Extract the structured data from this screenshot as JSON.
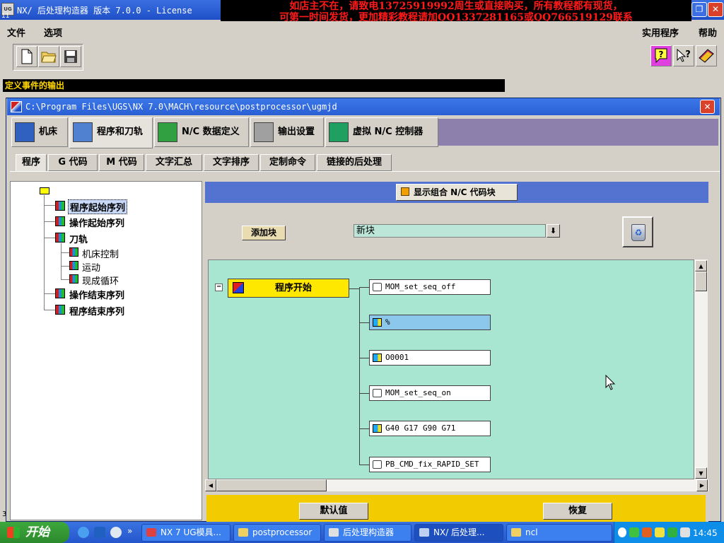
{
  "window": {
    "title": "NX/ 后处理构造器 版本 7.0.0 - License",
    "logo_text": "UG",
    "corner_number": "11",
    "restore_glyph": "❐",
    "close_glyph": "✕"
  },
  "ad_banner": {
    "line1": "如店主不在，请致电13725919992周生或直接购买，所有教程都有现货，",
    "line2": "可第一时间发货，更加精彩教程请加QQ1337281165或QQ766519129联系"
  },
  "menubar": {
    "file": "文件",
    "options": "选项",
    "utilities": "实用程序",
    "help": "帮助"
  },
  "toolbar": {
    "icons": [
      "new-file-icon",
      "open-folder-icon",
      "save-icon",
      "help-question-icon",
      "context-help-icon",
      "manual-book-icon"
    ]
  },
  "status_bar": "定义事件的输出",
  "inner_window": {
    "path": "C:\\Program Files\\UGS\\NX 7.0\\MACH\\resource\\postprocessor\\ugmjd",
    "close_glyph": "✕"
  },
  "main_tabs": [
    {
      "label": "机床",
      "icon": "machine-tool-icon",
      "color": "#3060c0"
    },
    {
      "label": "程序和刀轨",
      "icon": "program-toolpath-icon",
      "color": "#5080d0"
    },
    {
      "label": "N/C 数据定义",
      "icon": "nc-data-icon",
      "color": "#30a040"
    },
    {
      "label": "输出设置",
      "icon": "printer-icon",
      "color": "#a0a0a0"
    },
    {
      "label": "虚拟 N/C 控制器",
      "icon": "virtual-controller-icon",
      "color": "#20a060"
    }
  ],
  "sub_tabs": [
    "程序",
    "G 代码",
    "M 代码",
    "文字汇总",
    "文字排序",
    "定制命令",
    "链接的后处理"
  ],
  "tree": {
    "nodes": [
      "程序起始序列",
      "操作起始序列",
      "刀轨",
      "操作结束序列",
      "程序结束序列"
    ],
    "children": [
      "机床控制",
      "运动",
      "现成循环"
    ]
  },
  "panel": {
    "show_blocks_label": "显示组合 N/C 代码块",
    "add_block_label": "添加块",
    "new_block_value": "新块",
    "dropdown_glyph": "⬇",
    "trash_icon": "recycle-bin-icon",
    "expander_glyph": "−"
  },
  "flow": {
    "start_node": "程序开始",
    "blocks": [
      {
        "label": "MOM_set_seq_off",
        "icon": "hand"
      },
      {
        "label": "%",
        "icon": "cube"
      },
      {
        "label": "O0001",
        "icon": "cube"
      },
      {
        "label": "MOM_set_seq_on",
        "icon": "hand"
      },
      {
        "label": "G40 G17 G90 G71",
        "icon": "cube"
      },
      {
        "label": "PB_CMD_fix_RAPID_SET",
        "icon": "hand"
      }
    ]
  },
  "buttons": {
    "default": "默认值",
    "restore": "恢复"
  },
  "taskbar": {
    "start": "开始",
    "overflow": "»",
    "tasks": [
      "NX 7 UG模具...",
      "postprocessor",
      "后处理构造器",
      "NX/ 后处理...",
      "ncl"
    ],
    "clock": "14:45"
  },
  "left_marker": "3"
}
